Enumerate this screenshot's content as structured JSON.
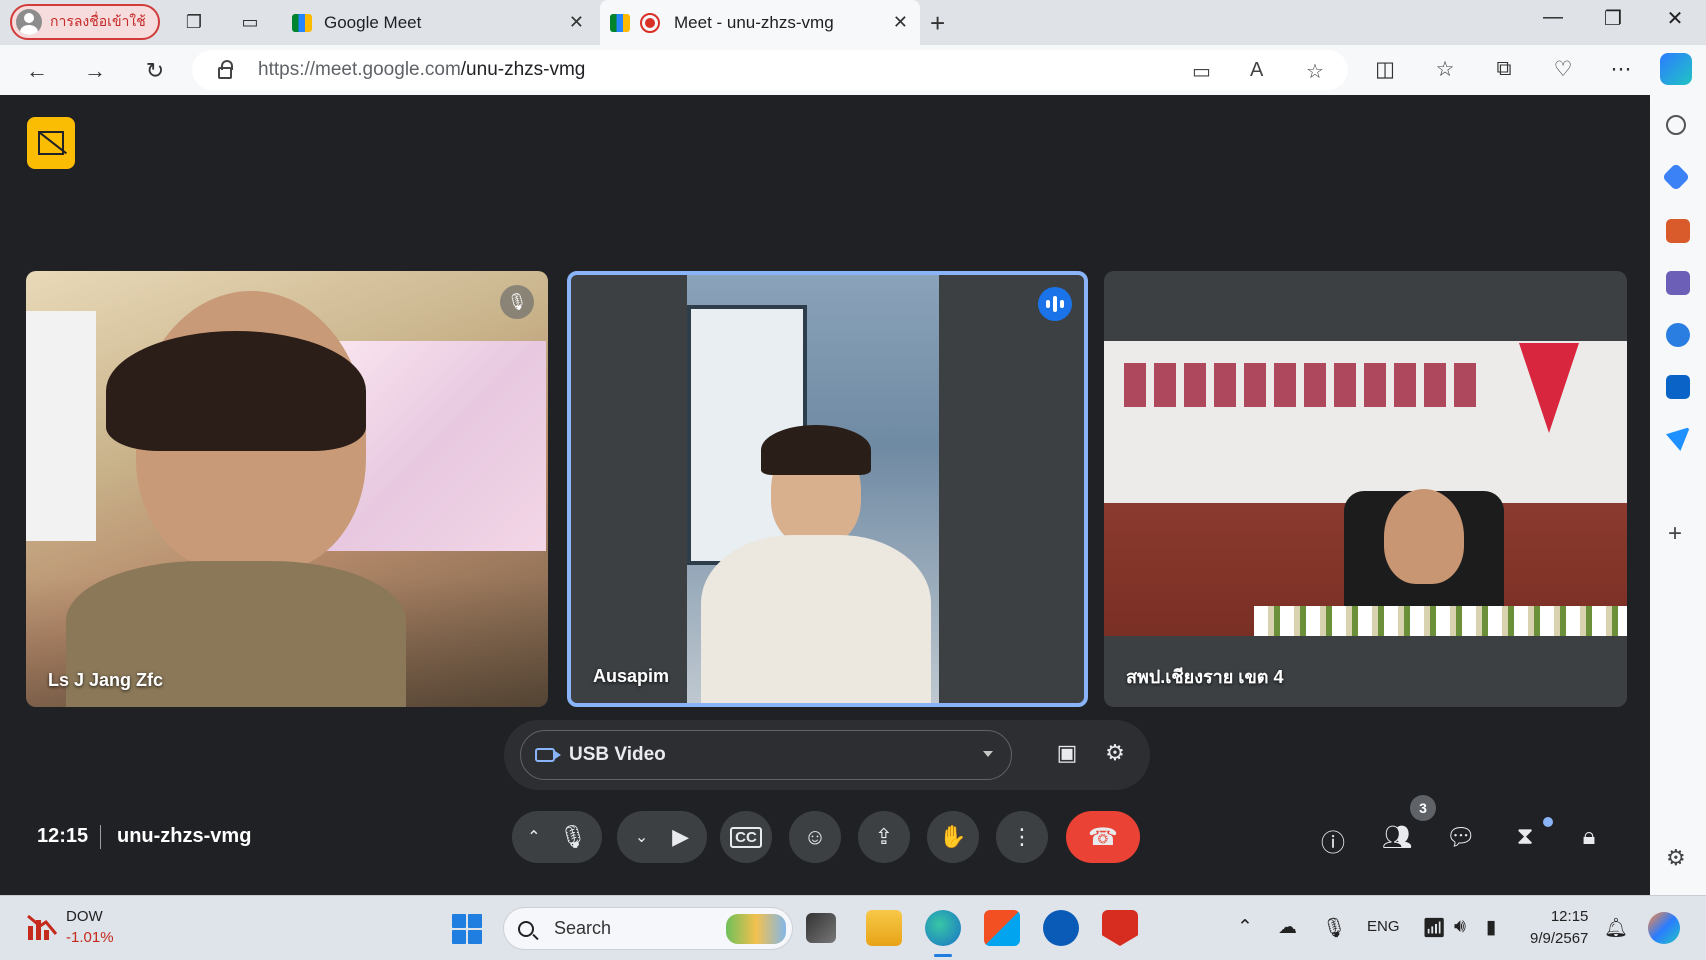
{
  "browser": {
    "profile_label": "การลงชื่อเข้าใช้",
    "tabs": [
      {
        "title": "Google Meet"
      },
      {
        "title": "Meet - unu-zhzs-vmg"
      }
    ],
    "url_host": "https://meet.google.com",
    "url_path": "/unu-zhzs-vmg"
  },
  "meeting": {
    "time": "12:15",
    "code": "unu-zhzs-vmg",
    "participant_count": "3",
    "participants": [
      {
        "name": "Ls J Jang Zfc",
        "muted": true
      },
      {
        "name": "Ausapim",
        "speaking": true
      },
      {
        "name": "สพป.เชียงราย เขต 4"
      }
    ],
    "camera_source": "USB Video"
  },
  "taskbar": {
    "stock_name": "DOW",
    "stock_change": "-1.01%",
    "search_label": "Search",
    "language": "ENG",
    "clock_time": "12:15",
    "clock_date": "9/9/2567"
  },
  "colors": {
    "accent_blue": "#8ab4f8",
    "end_call_red": "#ea4335",
    "badge_yellow": "#fbbc04"
  }
}
